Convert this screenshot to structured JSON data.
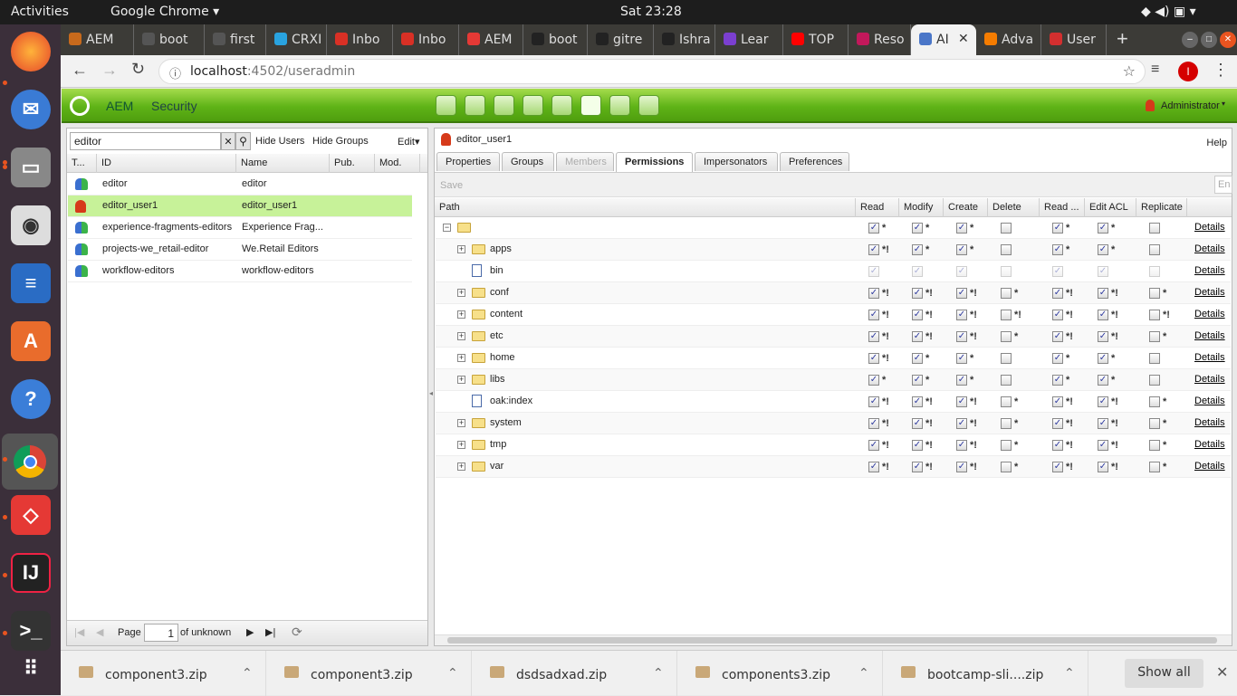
{
  "os": {
    "activities": "Activities",
    "app": "Google Chrome ▾",
    "clock": "Sat 23:28"
  },
  "browser": {
    "tabs": [
      "AEM",
      "boot",
      "first",
      "CRXI",
      "Inbo",
      "Inbo",
      "AEM",
      "boot",
      "gitre",
      "Ishra",
      "Lear",
      "TOP",
      "Reso",
      "AI",
      "Adva",
      "User"
    ],
    "tab_colors": [
      "#c86a1c",
      "#555",
      "#555",
      "#29a3e0",
      "#d93025",
      "#d93025",
      "#e53935",
      "#222",
      "#222",
      "#222",
      "#7b3fd0",
      "#ff0000",
      "#c2185b",
      "#4a76c8",
      "#f57c00",
      "#d32f2f"
    ],
    "url_host": "localhost",
    "url_rest": ":4502/useradmin",
    "profile": "I"
  },
  "aem": {
    "logo": "AEM",
    "section": "Security",
    "user": "Administrator"
  },
  "left": {
    "search": "editor",
    "hide_users": "Hide Users",
    "hide_groups": "Hide Groups",
    "edit": "Edit",
    "columns": [
      "T...",
      "ID",
      "Name",
      "Pub.",
      "Mod."
    ],
    "rows": [
      {
        "type": "group",
        "id": "editor",
        "name": "editor"
      },
      {
        "type": "user",
        "id": "editor_user1",
        "name": "editor_user1",
        "selected": true
      },
      {
        "type": "group",
        "id": "experience-fragments-editors",
        "name": "Experience Frag..."
      },
      {
        "type": "group",
        "id": "projects-we_retail-editor",
        "name": "We.Retail Editors"
      },
      {
        "type": "group",
        "id": "workflow-editors",
        "name": "workflow-editors"
      }
    ],
    "pager": {
      "page_label": "Page",
      "page": "1",
      "of": "of unknown"
    }
  },
  "right": {
    "title": "editor_user1",
    "help": "Help",
    "tabs": [
      "Properties",
      "Groups",
      "Members",
      "Permissions",
      "Impersonators",
      "Preferences"
    ],
    "save": "Save",
    "columns": [
      "Path",
      "Read",
      "Modify",
      "Create",
      "Delete",
      "Read ...",
      "Edit ACL",
      "Replicate"
    ],
    "details": "Details",
    "rows": [
      {
        "path": "",
        "kind": "folder",
        "level": 0,
        "cells": [
          "c*",
          "c*",
          "c*",
          "u",
          "c*",
          "c*",
          "u"
        ]
      },
      {
        "path": "apps",
        "kind": "folder",
        "level": 1,
        "cells": [
          "c*!",
          "c*",
          "c*",
          "u",
          "c*",
          "c*",
          "u"
        ]
      },
      {
        "path": "bin",
        "kind": "file",
        "level": 1,
        "cells": [
          "dc",
          "dc",
          "dc",
          "du",
          "dc",
          "dc",
          "du"
        ]
      },
      {
        "path": "conf",
        "kind": "folder",
        "level": 1,
        "cells": [
          "c*!",
          "c*!",
          "c*!",
          "u*",
          "c*!",
          "c*!",
          "u*"
        ]
      },
      {
        "path": "content",
        "kind": "folder",
        "level": 1,
        "cells": [
          "c*!",
          "c*!",
          "c*!",
          "u*!",
          "c*!",
          "c*!",
          "u*!"
        ]
      },
      {
        "path": "etc",
        "kind": "folder",
        "level": 1,
        "cells": [
          "c*!",
          "c*!",
          "c*!",
          "u*",
          "c*!",
          "c*!",
          "u*"
        ]
      },
      {
        "path": "home",
        "kind": "folder",
        "level": 1,
        "cells": [
          "c*!",
          "c*",
          "c*",
          "u",
          "c*",
          "c*",
          "u"
        ]
      },
      {
        "path": "libs",
        "kind": "folder",
        "level": 1,
        "cells": [
          "c*",
          "c*",
          "c*",
          "u",
          "c*",
          "c*",
          "u"
        ]
      },
      {
        "path": "oak:index",
        "kind": "file",
        "level": 1,
        "cells": [
          "c*!",
          "c*!",
          "c*!",
          "u*",
          "c*!",
          "c*!",
          "u*"
        ]
      },
      {
        "path": "system",
        "kind": "folder",
        "level": 1,
        "cells": [
          "c*!",
          "c*!",
          "c*!",
          "u*",
          "c*!",
          "c*!",
          "u*"
        ]
      },
      {
        "path": "tmp",
        "kind": "folder",
        "level": 1,
        "cells": [
          "c*!",
          "c*!",
          "c*!",
          "u*",
          "c*!",
          "c*!",
          "u*"
        ]
      },
      {
        "path": "var",
        "kind": "folder",
        "level": 1,
        "cells": [
          "c*!",
          "c*!",
          "c*!",
          "u*",
          "c*!",
          "c*!",
          "u*"
        ]
      }
    ]
  },
  "downloads": {
    "items": [
      "component3.zip",
      "component3.zip",
      "dsdsadxad.zip",
      "components3.zip",
      "bootcamp-sli....zip"
    ],
    "show_all": "Show all"
  }
}
